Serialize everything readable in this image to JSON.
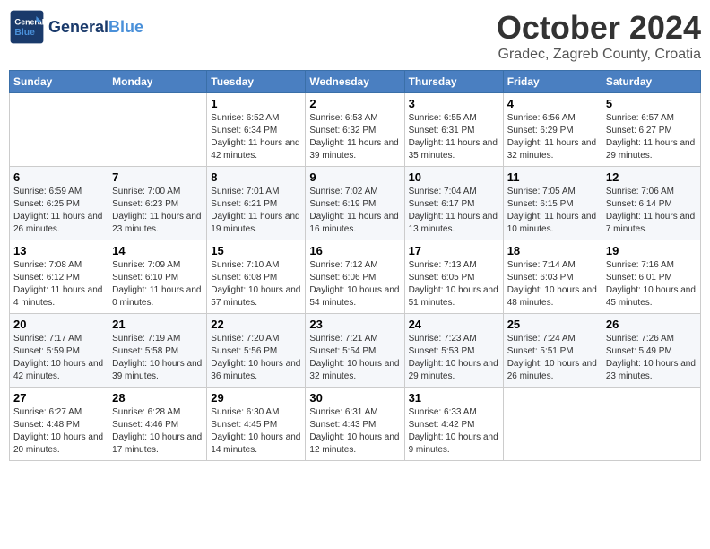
{
  "header": {
    "logo_general": "General",
    "logo_blue": "Blue",
    "month_title": "October 2024",
    "subtitle": "Gradec, Zagreb County, Croatia"
  },
  "days_of_week": [
    "Sunday",
    "Monday",
    "Tuesday",
    "Wednesday",
    "Thursday",
    "Friday",
    "Saturday"
  ],
  "weeks": [
    [
      {
        "day": "",
        "sunrise": "",
        "sunset": "",
        "daylight": ""
      },
      {
        "day": "",
        "sunrise": "",
        "sunset": "",
        "daylight": ""
      },
      {
        "day": "1",
        "sunrise": "Sunrise: 6:52 AM",
        "sunset": "Sunset: 6:34 PM",
        "daylight": "Daylight: 11 hours and 42 minutes."
      },
      {
        "day": "2",
        "sunrise": "Sunrise: 6:53 AM",
        "sunset": "Sunset: 6:32 PM",
        "daylight": "Daylight: 11 hours and 39 minutes."
      },
      {
        "day": "3",
        "sunrise": "Sunrise: 6:55 AM",
        "sunset": "Sunset: 6:31 PM",
        "daylight": "Daylight: 11 hours and 35 minutes."
      },
      {
        "day": "4",
        "sunrise": "Sunrise: 6:56 AM",
        "sunset": "Sunset: 6:29 PM",
        "daylight": "Daylight: 11 hours and 32 minutes."
      },
      {
        "day": "5",
        "sunrise": "Sunrise: 6:57 AM",
        "sunset": "Sunset: 6:27 PM",
        "daylight": "Daylight: 11 hours and 29 minutes."
      }
    ],
    [
      {
        "day": "6",
        "sunrise": "Sunrise: 6:59 AM",
        "sunset": "Sunset: 6:25 PM",
        "daylight": "Daylight: 11 hours and 26 minutes."
      },
      {
        "day": "7",
        "sunrise": "Sunrise: 7:00 AM",
        "sunset": "Sunset: 6:23 PM",
        "daylight": "Daylight: 11 hours and 23 minutes."
      },
      {
        "day": "8",
        "sunrise": "Sunrise: 7:01 AM",
        "sunset": "Sunset: 6:21 PM",
        "daylight": "Daylight: 11 hours and 19 minutes."
      },
      {
        "day": "9",
        "sunrise": "Sunrise: 7:02 AM",
        "sunset": "Sunset: 6:19 PM",
        "daylight": "Daylight: 11 hours and 16 minutes."
      },
      {
        "day": "10",
        "sunrise": "Sunrise: 7:04 AM",
        "sunset": "Sunset: 6:17 PM",
        "daylight": "Daylight: 11 hours and 13 minutes."
      },
      {
        "day": "11",
        "sunrise": "Sunrise: 7:05 AM",
        "sunset": "Sunset: 6:15 PM",
        "daylight": "Daylight: 11 hours and 10 minutes."
      },
      {
        "day": "12",
        "sunrise": "Sunrise: 7:06 AM",
        "sunset": "Sunset: 6:14 PM",
        "daylight": "Daylight: 11 hours and 7 minutes."
      }
    ],
    [
      {
        "day": "13",
        "sunrise": "Sunrise: 7:08 AM",
        "sunset": "Sunset: 6:12 PM",
        "daylight": "Daylight: 11 hours and 4 minutes."
      },
      {
        "day": "14",
        "sunrise": "Sunrise: 7:09 AM",
        "sunset": "Sunset: 6:10 PM",
        "daylight": "Daylight: 11 hours and 0 minutes."
      },
      {
        "day": "15",
        "sunrise": "Sunrise: 7:10 AM",
        "sunset": "Sunset: 6:08 PM",
        "daylight": "Daylight: 10 hours and 57 minutes."
      },
      {
        "day": "16",
        "sunrise": "Sunrise: 7:12 AM",
        "sunset": "Sunset: 6:06 PM",
        "daylight": "Daylight: 10 hours and 54 minutes."
      },
      {
        "day": "17",
        "sunrise": "Sunrise: 7:13 AM",
        "sunset": "Sunset: 6:05 PM",
        "daylight": "Daylight: 10 hours and 51 minutes."
      },
      {
        "day": "18",
        "sunrise": "Sunrise: 7:14 AM",
        "sunset": "Sunset: 6:03 PM",
        "daylight": "Daylight: 10 hours and 48 minutes."
      },
      {
        "day": "19",
        "sunrise": "Sunrise: 7:16 AM",
        "sunset": "Sunset: 6:01 PM",
        "daylight": "Daylight: 10 hours and 45 minutes."
      }
    ],
    [
      {
        "day": "20",
        "sunrise": "Sunrise: 7:17 AM",
        "sunset": "Sunset: 5:59 PM",
        "daylight": "Daylight: 10 hours and 42 minutes."
      },
      {
        "day": "21",
        "sunrise": "Sunrise: 7:19 AM",
        "sunset": "Sunset: 5:58 PM",
        "daylight": "Daylight: 10 hours and 39 minutes."
      },
      {
        "day": "22",
        "sunrise": "Sunrise: 7:20 AM",
        "sunset": "Sunset: 5:56 PM",
        "daylight": "Daylight: 10 hours and 36 minutes."
      },
      {
        "day": "23",
        "sunrise": "Sunrise: 7:21 AM",
        "sunset": "Sunset: 5:54 PM",
        "daylight": "Daylight: 10 hours and 32 minutes."
      },
      {
        "day": "24",
        "sunrise": "Sunrise: 7:23 AM",
        "sunset": "Sunset: 5:53 PM",
        "daylight": "Daylight: 10 hours and 29 minutes."
      },
      {
        "day": "25",
        "sunrise": "Sunrise: 7:24 AM",
        "sunset": "Sunset: 5:51 PM",
        "daylight": "Daylight: 10 hours and 26 minutes."
      },
      {
        "day": "26",
        "sunrise": "Sunrise: 7:26 AM",
        "sunset": "Sunset: 5:49 PM",
        "daylight": "Daylight: 10 hours and 23 minutes."
      }
    ],
    [
      {
        "day": "27",
        "sunrise": "Sunrise: 6:27 AM",
        "sunset": "Sunset: 4:48 PM",
        "daylight": "Daylight: 10 hours and 20 minutes."
      },
      {
        "day": "28",
        "sunrise": "Sunrise: 6:28 AM",
        "sunset": "Sunset: 4:46 PM",
        "daylight": "Daylight: 10 hours and 17 minutes."
      },
      {
        "day": "29",
        "sunrise": "Sunrise: 6:30 AM",
        "sunset": "Sunset: 4:45 PM",
        "daylight": "Daylight: 10 hours and 14 minutes."
      },
      {
        "day": "30",
        "sunrise": "Sunrise: 6:31 AM",
        "sunset": "Sunset: 4:43 PM",
        "daylight": "Daylight: 10 hours and 12 minutes."
      },
      {
        "day": "31",
        "sunrise": "Sunrise: 6:33 AM",
        "sunset": "Sunset: 4:42 PM",
        "daylight": "Daylight: 10 hours and 9 minutes."
      },
      {
        "day": "",
        "sunrise": "",
        "sunset": "",
        "daylight": ""
      },
      {
        "day": "",
        "sunrise": "",
        "sunset": "",
        "daylight": ""
      }
    ]
  ]
}
